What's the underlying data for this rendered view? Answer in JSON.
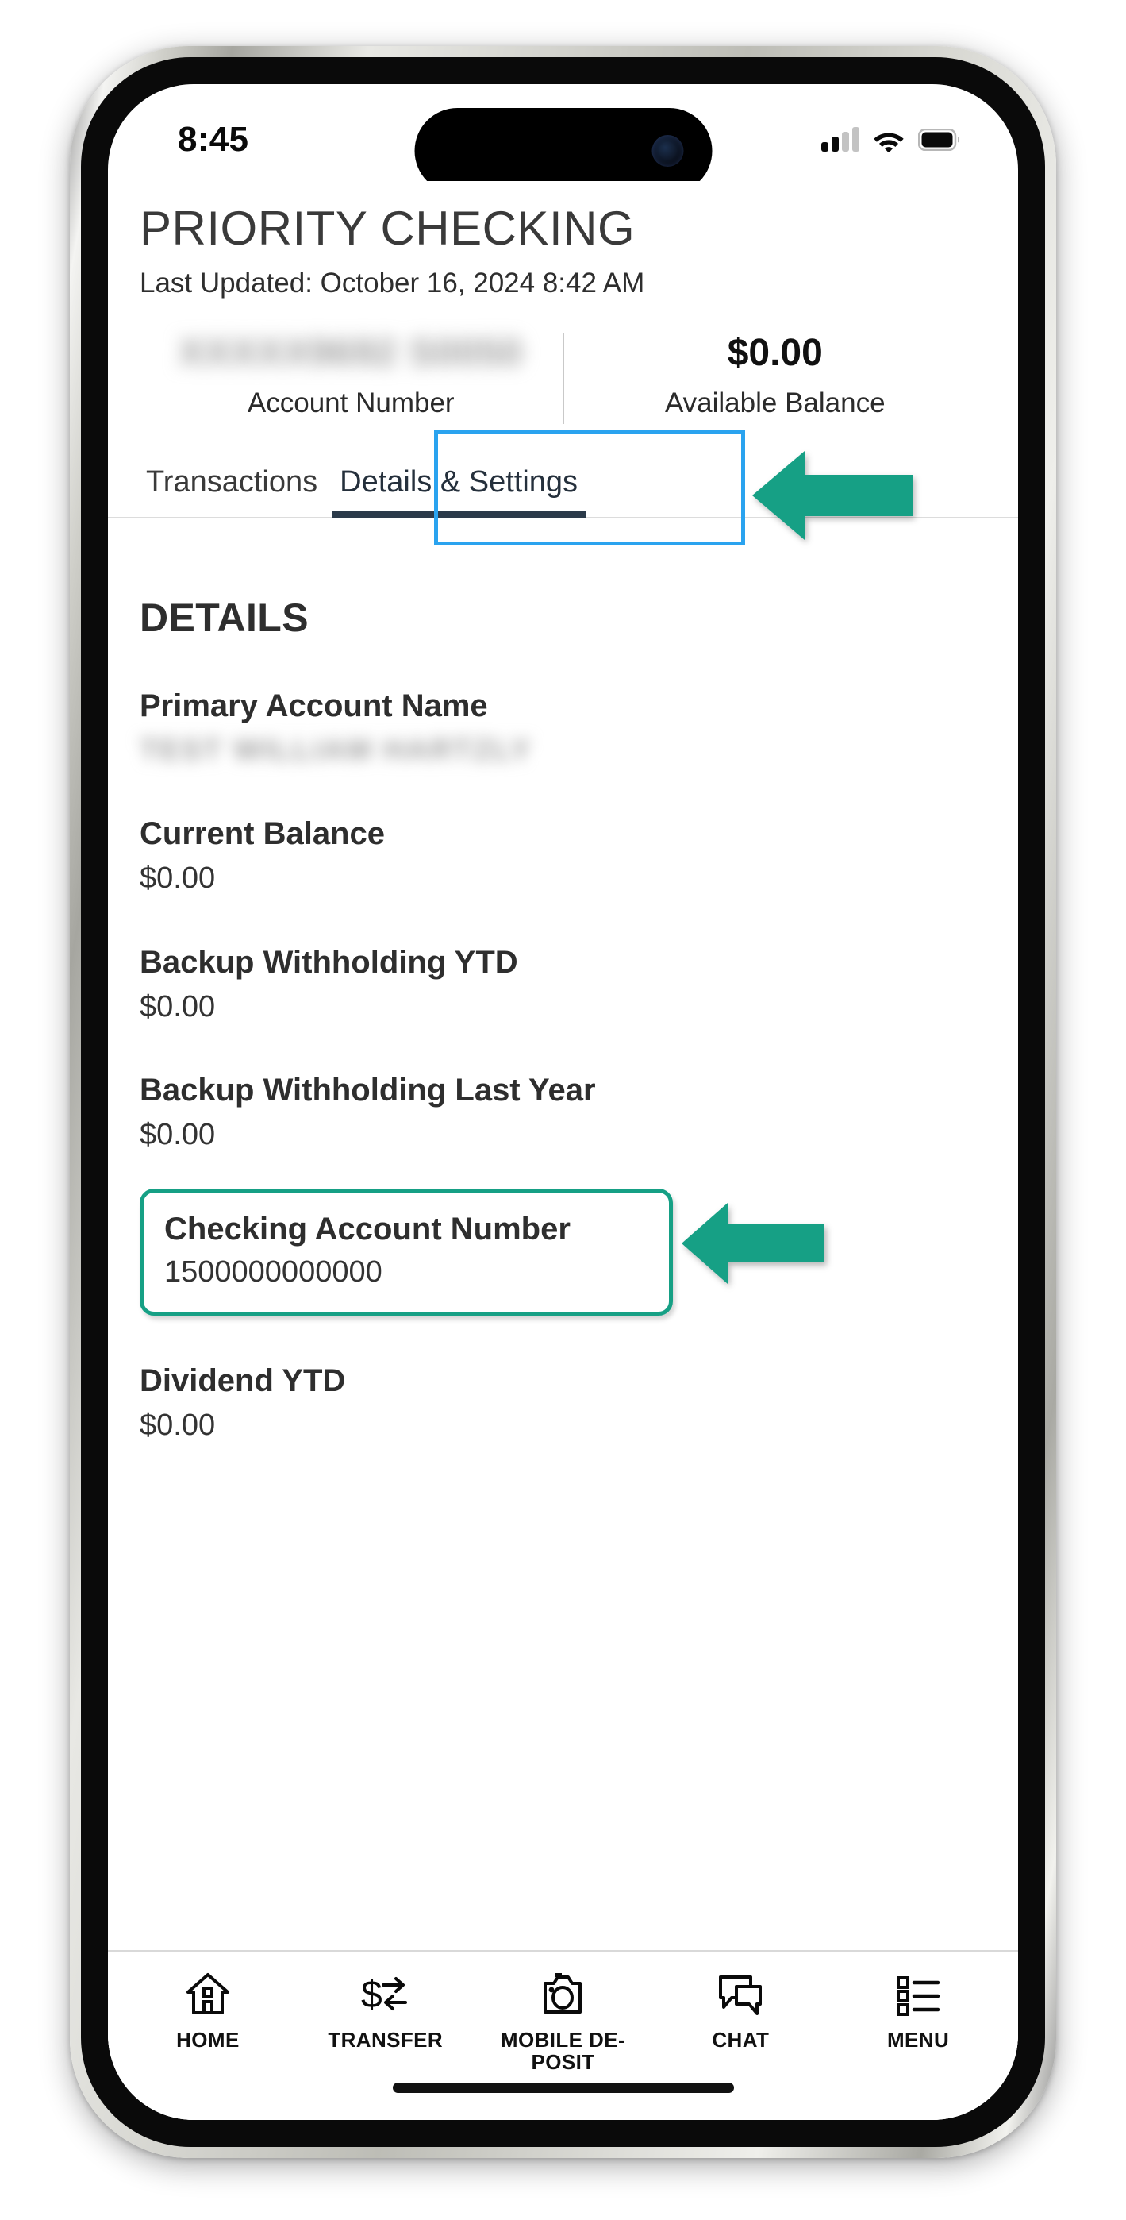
{
  "status_bar": {
    "time": "8:45",
    "cellular_icon": "cellular-signal-icon",
    "cellular_bars_filled": 2,
    "cellular_bars_total": 4,
    "wifi_icon": "wifi-icon",
    "battery_icon": "battery-full-icon"
  },
  "header": {
    "title": "PRIORITY CHECKING",
    "last_updated": "Last Updated: October 16, 2024 8:42 AM"
  },
  "summary": {
    "account_number_value": "XXXXX9692 S0050",
    "account_number_label": "Account Number",
    "available_balance_value": "$0.00",
    "available_balance_label": "Available Balance"
  },
  "tabs": [
    {
      "label": "Transactions",
      "active": false
    },
    {
      "label": "Details & Settings",
      "active": true
    }
  ],
  "details": {
    "section_title": "DETAILS",
    "fields": [
      {
        "label": "Primary Account Name",
        "value": "TEST WILLIAM HARTZLY",
        "redacted": true,
        "highlighted": false
      },
      {
        "label": "Current Balance",
        "value": "$0.00",
        "redacted": false,
        "highlighted": false
      },
      {
        "label": "Backup Withholding YTD",
        "value": "$0.00",
        "redacted": false,
        "highlighted": false
      },
      {
        "label": "Backup Withholding Last Year",
        "value": "$0.00",
        "redacted": false,
        "highlighted": false
      },
      {
        "label": "Checking Account Number",
        "value": "1500000000000",
        "redacted": false,
        "highlighted": true
      },
      {
        "label": "Dividend YTD",
        "value": "$0.00",
        "redacted": false,
        "highlighted": false
      }
    ]
  },
  "bottom_nav": [
    {
      "label": "HOME",
      "icon": "home-icon"
    },
    {
      "label": "TRANSFER",
      "icon": "transfer-icon"
    },
    {
      "label": "MOBILE DE-POSIT",
      "icon": "camera-icon"
    },
    {
      "label": "CHAT",
      "icon": "chat-bubble-icon"
    },
    {
      "label": "MENU",
      "icon": "list-menu-icon"
    }
  ],
  "annotations": {
    "tab_highlight_color": "#2aa3ef",
    "field_highlight_color": "#16a085",
    "arrow_color": "#16a085",
    "tab_arrow_name": "callout-arrow-details-settings",
    "field_arrow_name": "callout-arrow-checking-account-number"
  }
}
